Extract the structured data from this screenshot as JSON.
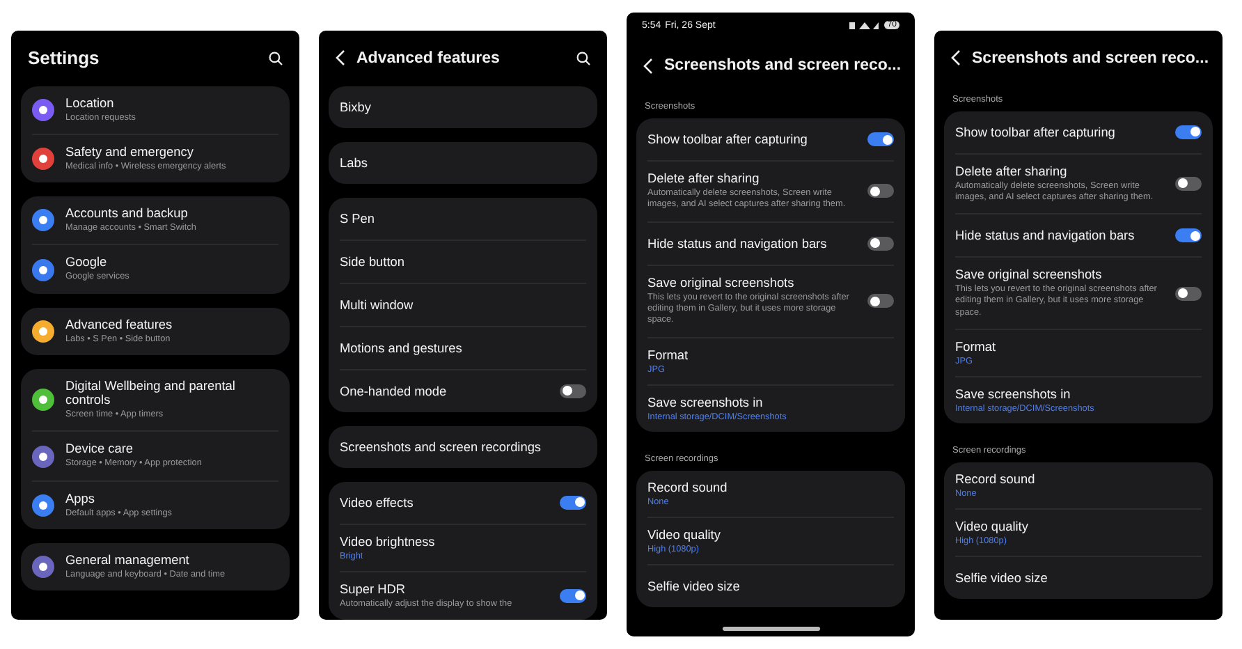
{
  "phones": [
    {
      "header": {
        "title": "Settings",
        "back": false,
        "search": true
      },
      "sections": [
        {
          "items": [
            {
              "kind": "link",
              "title": "Location",
              "subtitle": "Location requests",
              "color": "#7b5cf2"
            },
            {
              "kind": "link",
              "title": "Safety and emergency",
              "subtitle": "Medical info • Wireless emergency alerts",
              "color": "#e0413b"
            }
          ]
        },
        {
          "items": [
            {
              "kind": "link",
              "title": "Accounts and backup",
              "subtitle": "Manage accounts • Smart Switch",
              "color": "#3b7ef2"
            },
            {
              "kind": "link",
              "title": "Google",
              "subtitle": "Google services",
              "color": "#3a78ee"
            }
          ]
        },
        {
          "items": [
            {
              "kind": "link",
              "title": "Advanced features",
              "subtitle": "Labs • S Pen • Side button",
              "color": "#f6ad2f"
            }
          ]
        },
        {
          "items": [
            {
              "kind": "link",
              "title": "Digital Wellbeing and parental controls",
              "subtitle": "Screen time • App timers",
              "color": "#4fbe3a"
            },
            {
              "kind": "link",
              "title": "Device care",
              "subtitle": "Storage • Memory • App protection",
              "color": "#6b66bd"
            },
            {
              "kind": "link",
              "title": "Apps",
              "subtitle": "Default apps • App settings",
              "color": "#3b7ef2"
            }
          ]
        },
        {
          "items": [
            {
              "kind": "link",
              "title": "General management",
              "subtitle": "Language and keyboard • Date and time",
              "color": "#6b66bd"
            }
          ]
        }
      ]
    },
    {
      "header": {
        "title": "Advanced features",
        "back": true,
        "search": true
      },
      "sections": [
        {
          "items": [
            {
              "kind": "link",
              "title": "Bixby"
            }
          ]
        },
        {
          "items": [
            {
              "kind": "link",
              "title": "Labs"
            }
          ]
        },
        {
          "items": [
            {
              "kind": "link",
              "title": "S Pen"
            },
            {
              "kind": "link",
              "title": "Side button"
            },
            {
              "kind": "link",
              "title": "Multi window"
            },
            {
              "kind": "link",
              "title": "Motions and gestures"
            },
            {
              "kind": "toggle",
              "title": "One-handed mode",
              "on": false
            }
          ]
        },
        {
          "items": [
            {
              "kind": "link",
              "title": "Screenshots and screen recordings"
            }
          ]
        },
        {
          "items": [
            {
              "kind": "toggle",
              "title": "Video effects",
              "on": true
            },
            {
              "kind": "link",
              "title": "Video brightness",
              "value": "Bright"
            },
            {
              "kind": "toggle",
              "title": "Super HDR",
              "subtitle": "Automatically adjust the display to show the",
              "on": true
            }
          ]
        }
      ]
    },
    {
      "status_bar": {
        "time": "5:54",
        "date": "Fri, 26 Sept",
        "battery": "70"
      },
      "header": {
        "title": "Screenshots and screen reco...",
        "back": true,
        "search": false
      },
      "home_indicator": true,
      "sections": [
        {
          "label": "Screenshots",
          "items": [
            {
              "kind": "toggle",
              "title": "Show toolbar after capturing",
              "on": true
            },
            {
              "kind": "toggle",
              "title": "Delete after sharing",
              "subtitle": "Automatically delete screenshots, Screen write images, and AI select captures after sharing them.",
              "on": false
            },
            {
              "kind": "toggle",
              "title": "Hide status and navigation bars",
              "on": false
            },
            {
              "kind": "toggle",
              "title": "Save original screenshots",
              "subtitle": "This lets you revert to the original screenshots after editing them in Gallery, but it uses more storage space.",
              "on": false
            },
            {
              "kind": "link",
              "title": "Format",
              "value": "JPG"
            },
            {
              "kind": "link",
              "title": "Save screenshots in",
              "value": "Internal storage/DCIM/Screenshots"
            }
          ]
        },
        {
          "label": "Screen recordings",
          "items": [
            {
              "kind": "link",
              "title": "Record sound",
              "value": "None"
            },
            {
              "kind": "link",
              "title": "Video quality",
              "value": "High (1080p)"
            },
            {
              "kind": "link",
              "title": "Selfie video size"
            }
          ]
        }
      ]
    },
    {
      "header": {
        "title": "Screenshots and screen reco...",
        "back": true,
        "search": false
      },
      "sections": [
        {
          "label": "Screenshots",
          "items": [
            {
              "kind": "toggle",
              "title": "Show toolbar after capturing",
              "on": true
            },
            {
              "kind": "toggle",
              "title": "Delete after sharing",
              "subtitle": "Automatically delete screenshots, Screen write images, and AI select captures after sharing them.",
              "on": false
            },
            {
              "kind": "toggle",
              "title": "Hide status and navigation bars",
              "on": true
            },
            {
              "kind": "toggle",
              "title": "Save original screenshots",
              "subtitle": "This lets you revert to the original screenshots after editing them in Gallery, but it uses more storage space.",
              "on": false
            },
            {
              "kind": "link",
              "title": "Format",
              "value": "JPG"
            },
            {
              "kind": "link",
              "title": "Save screenshots in",
              "value": "Internal storage/DCIM/Screenshots"
            }
          ]
        },
        {
          "label": "Screen recordings",
          "items": [
            {
              "kind": "link",
              "title": "Record sound",
              "value": "None"
            },
            {
              "kind": "link",
              "title": "Video quality",
              "value": "High (1080p)"
            },
            {
              "kind": "link",
              "title": "Selfie video size"
            }
          ]
        }
      ]
    }
  ]
}
